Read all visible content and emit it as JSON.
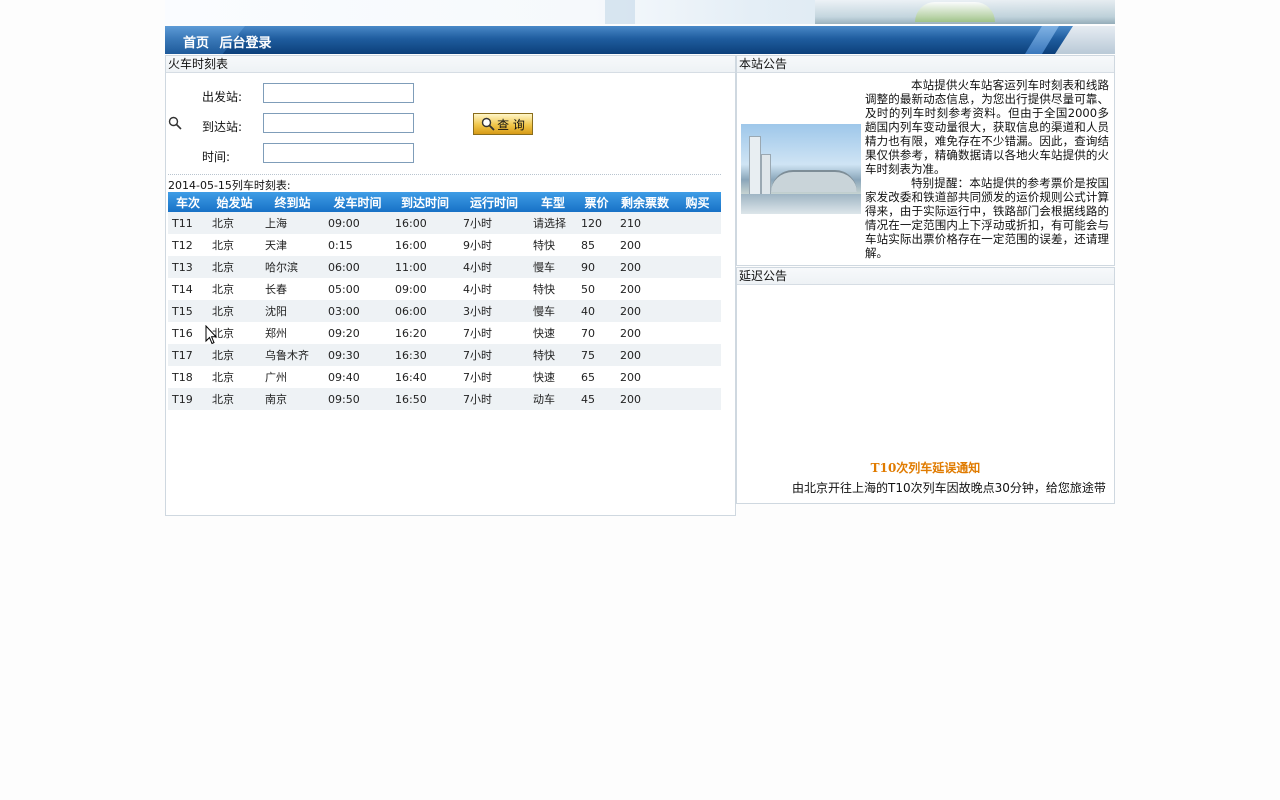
{
  "nav": {
    "home": "首页",
    "admin": "后台登录"
  },
  "schedule_panel": {
    "title": "火车时刻表",
    "labels": {
      "from": "出发站:",
      "to": "到达站:",
      "time": "时间:"
    },
    "inputs": {
      "from": "",
      "to": "",
      "time": ""
    },
    "query_button": "查 询",
    "caption": "2014-05-15列车时刻表:",
    "columns": [
      "车次",
      "始发站",
      "终到站",
      "发车时间",
      "到达时间",
      "运行时间",
      "车型",
      "票价",
      "剩余票数",
      "购买"
    ],
    "rows": [
      [
        "T11",
        "北京",
        "上海",
        "09:00",
        "16:00",
        "7小时",
        "请选择",
        "120",
        "210",
        ""
      ],
      [
        "T12",
        "北京",
        "天津",
        "0:15",
        "16:00",
        "9小时",
        "特快",
        "85",
        "200",
        ""
      ],
      [
        "T13",
        "北京",
        "哈尔滨",
        "06:00",
        "11:00",
        "4小时",
        "慢车",
        "90",
        "200",
        ""
      ],
      [
        "T14",
        "北京",
        "长春",
        "05:00",
        "09:00",
        "4小时",
        "特快",
        "50",
        "200",
        ""
      ],
      [
        "T15",
        "北京",
        "沈阳",
        "03:00",
        "06:00",
        "3小时",
        "慢车",
        "40",
        "200",
        ""
      ],
      [
        "T16",
        "北京",
        "郑州",
        "09:20",
        "16:20",
        "7小时",
        "快速",
        "70",
        "200",
        ""
      ],
      [
        "T17",
        "北京",
        "乌鲁木齐",
        "09:30",
        "16:30",
        "7小时",
        "特快",
        "75",
        "200",
        ""
      ],
      [
        "T18",
        "北京",
        "广州",
        "09:40",
        "16:40",
        "7小时",
        "快速",
        "65",
        "200",
        ""
      ],
      [
        "T19",
        "北京",
        "南京",
        "09:50",
        "16:50",
        "7小时",
        "动车",
        "45",
        "200",
        ""
      ]
    ]
  },
  "site_notice": {
    "title": "本站公告",
    "para1": "本站提供火车站客运列车时刻表和线路调整的最新动态信息，为您出行提供尽量可靠、及时的列车时刻参考资料。但由于全国2000多趟国内列车变动量很大，获取信息的渠道和人员精力也有限，难免存在不少错漏。因此，查询结果仅供参考，精确数据请以各地火车站提供的火车时刻表为准。",
    "para2": "特别提醒：本站提供的参考票价是按国家发改委和铁道部共同颁发的运价规则公式计算得来，由于实际运行中，铁路部门会根据线路的情况在一定范围内上下浮动或折扣，有可能会与车站实际出票价格存在一定范围的误差，还请理解。"
  },
  "delay_notice": {
    "title": "延迟公告",
    "headline": "T10次列车延误通知",
    "body": "由北京开往上海的T10次列车因故晚点30分钟，给您旅途带"
  }
}
